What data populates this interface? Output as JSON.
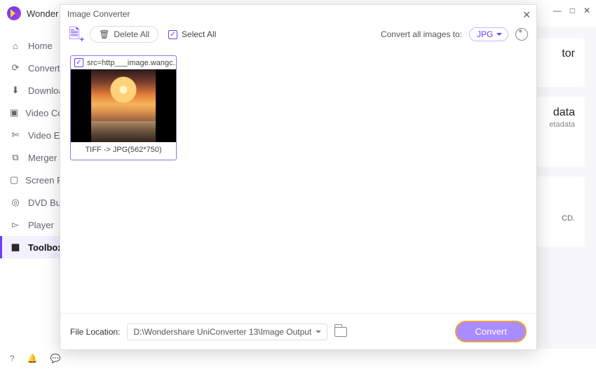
{
  "app": {
    "brand": "Wonder"
  },
  "window_controls": {
    "min": "—",
    "max": "□",
    "close": "✕"
  },
  "sidebar": {
    "items": [
      {
        "label": "Home",
        "icon": "⌂"
      },
      {
        "label": "Converter",
        "icon": "⟳"
      },
      {
        "label": "Downloader",
        "icon": "⬇"
      },
      {
        "label": "Video Compressor",
        "icon": "▣"
      },
      {
        "label": "Video Editor",
        "icon": "✄"
      },
      {
        "label": "Merger",
        "icon": "⧉"
      },
      {
        "label": "Screen Recorder",
        "icon": "▢"
      },
      {
        "label": "DVD Burner",
        "icon": "◎"
      },
      {
        "label": "Player",
        "icon": "▻"
      },
      {
        "label": "Toolbox",
        "icon": "▦"
      }
    ],
    "active_index": 9
  },
  "bg_panel": {
    "fragments": [
      "tor",
      "data",
      "etadata",
      "CD."
    ]
  },
  "modal": {
    "title": "Image Converter",
    "toolbar": {
      "delete_all": "Delete All",
      "select_all": "Select All",
      "convert_all_label": "Convert all images to:",
      "format_selected": "JPG"
    },
    "thumb": {
      "filename": "src=http___image.wangc...",
      "caption": "TIFF -> JPG(562*750)"
    },
    "footer": {
      "file_location_label": "File Location:",
      "file_location_value": "D:\\Wondershare UniConverter 13\\Image Output",
      "convert": "Convert"
    }
  }
}
